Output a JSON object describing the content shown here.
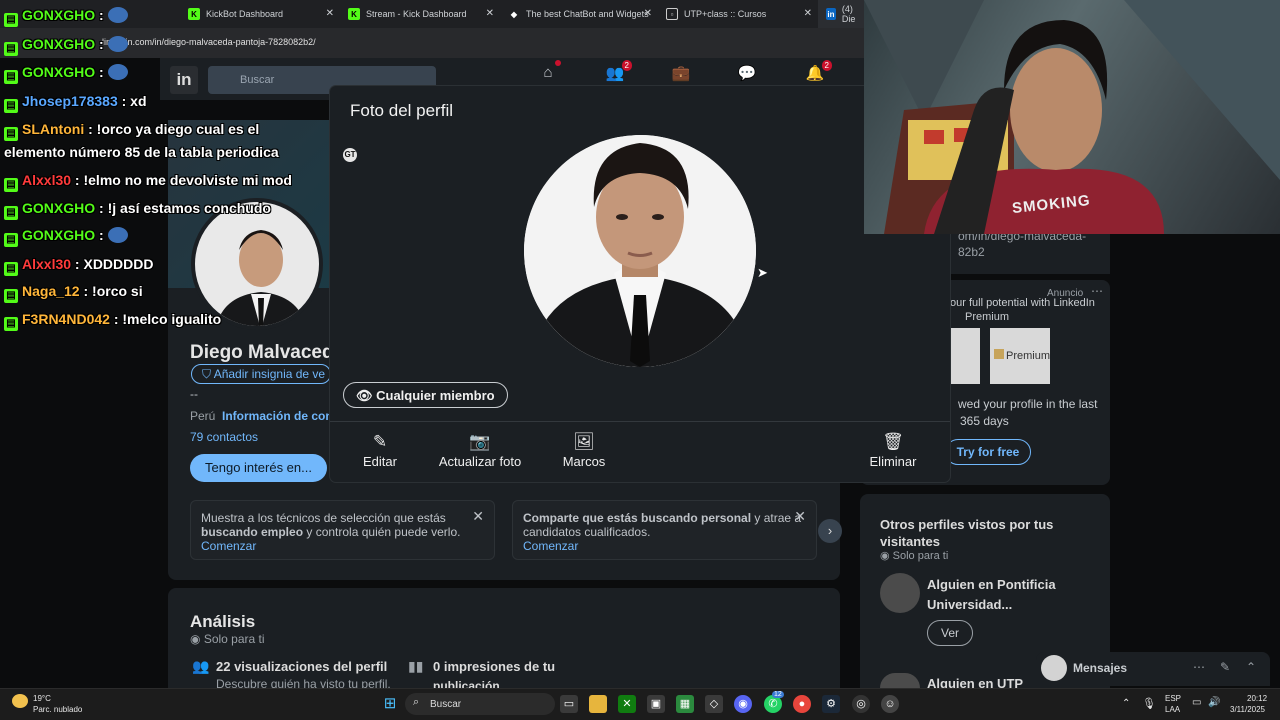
{
  "browser": {
    "tabs": [
      {
        "label": "KickBot Dashboard"
      },
      {
        "label": "Stream - Kick Dashboard"
      },
      {
        "label": "The best ChatBot and Widgets"
      },
      {
        "label": "UTP+class :: Cursos"
      },
      {
        "label": "(4) Die"
      }
    ],
    "url": "linkedin.com/in/diego-malvaceda-pantoja-7828082b2/"
  },
  "linkedin": {
    "search_placeholder": "Buscar",
    "nav_badges": {
      "network": "2",
      "notifications": "2"
    },
    "profile": {
      "name": "Diego Malvaced",
      "verify": "Añadir insignia de ve",
      "dash": "--",
      "location": "Perú",
      "contact_info": "Información de cont",
      "connections": "79 contactos",
      "open_to": "Tengo interés en..."
    },
    "suggestions": [
      {
        "text_a": "Muestra a los técnicos de selección que estás ",
        "text_b": "buscando empleo",
        "text_c": " y controla quién puede verlo.",
        "link": "Comenzar"
      },
      {
        "text_a": "Comparte que estás buscando personal",
        "text_b": " y atrae a candidatos cualificados.",
        "link": "Comenzar"
      }
    ],
    "analytics": {
      "title": "Análisis",
      "private": "Solo para ti",
      "views": "22 visualizaciones del perfil",
      "views_sub": "Descubre quién ha visto tu perfil.",
      "impressions": "0 impresiones de tu",
      "impressions_sub": "publicación"
    },
    "right": {
      "url_fragment_1": "om/in/diego-malvaceda-",
      "url_fragment_2": "82b2",
      "ad_label": "Anuncio",
      "ad_text": "our full potential with LinkedIn",
      "ad_text_2": "Premium",
      "premium_badge": "Premium",
      "viewed_text": "wed your profile in the last",
      "viewed_text_2": "365 days",
      "try_button": "Try for free",
      "others_title": "Otros perfiles vistos por tus visitantes",
      "others_private": "Solo para ti",
      "person1": "Alguien en Pontificia Universidad...",
      "view_button": "Ver",
      "person2": "Alguien en UTP",
      "messages": "Mensajes"
    }
  },
  "modal": {
    "title": "Foto del perfil",
    "visibility": "Cualquier miembro",
    "actions": {
      "edit": "Editar",
      "update": "Actualizar foto",
      "frames": "Marcos",
      "delete": "Eliminar"
    }
  },
  "chat": [
    {
      "user": "GONXGHO",
      "color": "#53fc18",
      "msg": "",
      "emote": true
    },
    {
      "user": "GONXGHO",
      "color": "#53fc18",
      "msg": "",
      "emote": true
    },
    {
      "user": "GONXGHO",
      "color": "#53fc18",
      "msg": "",
      "emote": true
    },
    {
      "user": "Jhosep178383",
      "color": "#5aa8ff",
      "msg": ": xd"
    },
    {
      "user": "SLAntoni",
      "color": "#ffb63a",
      "msg": ": !orco ya diego cual es el"
    },
    {
      "user": "",
      "color": "#fff",
      "msg": "elemento número 85 de la tabla periodica"
    },
    {
      "user": "Alxxl30",
      "color": "#ff3b3b",
      "msg": ": !elmo no me devolviste mi mod"
    },
    {
      "user": "GONXGHO",
      "color": "#53fc18",
      "msg": ": !j así estamos conchudo"
    },
    {
      "user": "GONXGHO",
      "color": "#53fc18",
      "msg": ":",
      "emote": true
    },
    {
      "user": "Alxxl30",
      "color": "#ff3b3b",
      "msg": ": XDDDDDD"
    },
    {
      "user": "Naga_12",
      "color": "#ffb63a",
      "msg": ": !orco si"
    },
    {
      "user": "F3RN4ND042",
      "color": "#ffb63a",
      "msg": ": !melco igualito"
    }
  ],
  "webcam": {
    "shirt_text": "SMOKING"
  },
  "taskbar": {
    "weather_temp": "19°C",
    "weather_desc": "Parc. nublado",
    "search": "Buscar",
    "lang_1": "ESP",
    "lang_2": "LAA",
    "time": "20:12",
    "date": "3/11/2025",
    "chrome_badge": "12"
  },
  "colors": {
    "linkedin_blue": "#71b7fb",
    "kick_green": "#53fc18",
    "modal_bg": "#1b1f23"
  }
}
